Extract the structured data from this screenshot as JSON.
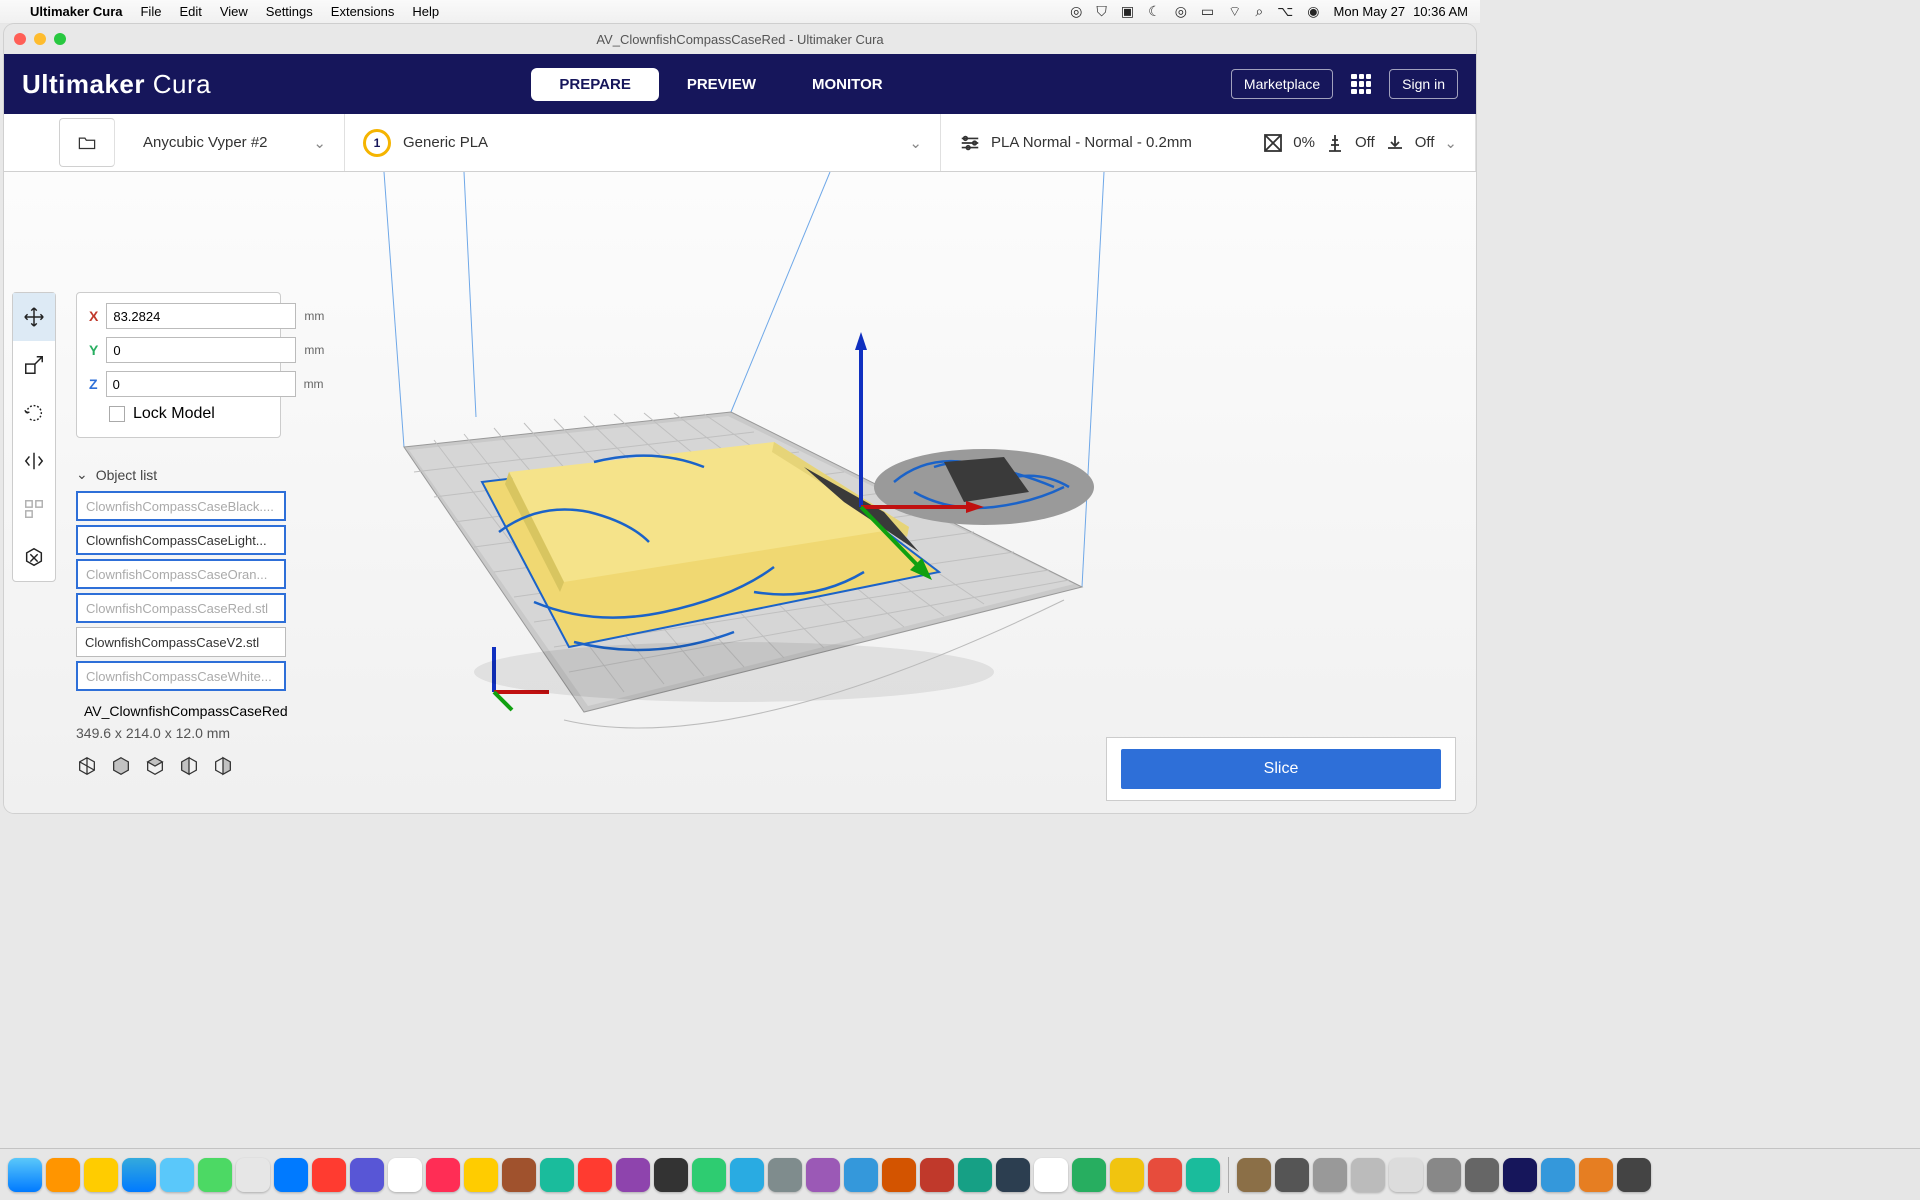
{
  "macos": {
    "app_name": "Ultimaker Cura",
    "menus": [
      "File",
      "Edit",
      "View",
      "Settings",
      "Extensions",
      "Help"
    ],
    "clock_day": "Mon May 27",
    "clock_time": "10:36 AM"
  },
  "window": {
    "title": "AV_ClownfishCompassCaseRed - Ultimaker Cura"
  },
  "header": {
    "brand_bold": "Ultimaker",
    "brand_light": "Cura",
    "tabs": {
      "prepare": "PREPARE",
      "preview": "PREVIEW",
      "monitor": "MONITOR"
    },
    "marketplace": "Marketplace",
    "signin": "Sign in"
  },
  "settings": {
    "printer": "Anycubic Vyper #2",
    "material": "Generic PLA",
    "extruder_badge": "1",
    "profile_name": "PLA Normal - Normal - 0.2mm",
    "infill": "0%",
    "support": "Off",
    "adhesion": "Off"
  },
  "transform": {
    "x_label": "X",
    "x_value": "83.2824",
    "x_unit": "mm",
    "y_label": "Y",
    "y_value": "0",
    "y_unit": "mm",
    "z_label": "Z",
    "z_value": "0",
    "z_unit": "mm",
    "lock": "Lock Model"
  },
  "objects": {
    "header": "Object list",
    "items": [
      {
        "label": "ClownfishCompassCaseBlack....",
        "selected": true,
        "dimmed": true
      },
      {
        "label": "ClownfishCompassCaseLight...",
        "selected": true,
        "dimmed": false
      },
      {
        "label": "ClownfishCompassCaseOran...",
        "selected": true,
        "dimmed": true
      },
      {
        "label": "ClownfishCompassCaseRed.stl",
        "selected": true,
        "dimmed": true
      },
      {
        "label": "ClownfishCompassCaseV2.stl",
        "selected": false,
        "dimmed": false
      },
      {
        "label": "ClownfishCompassCaseWhite...",
        "selected": true,
        "dimmed": true
      }
    ],
    "project_name": "AV_ClownfishCompassCaseRed",
    "dimensions": "349.6 x 214.0 x 12.0 mm"
  },
  "slice": {
    "label": "Slice"
  }
}
